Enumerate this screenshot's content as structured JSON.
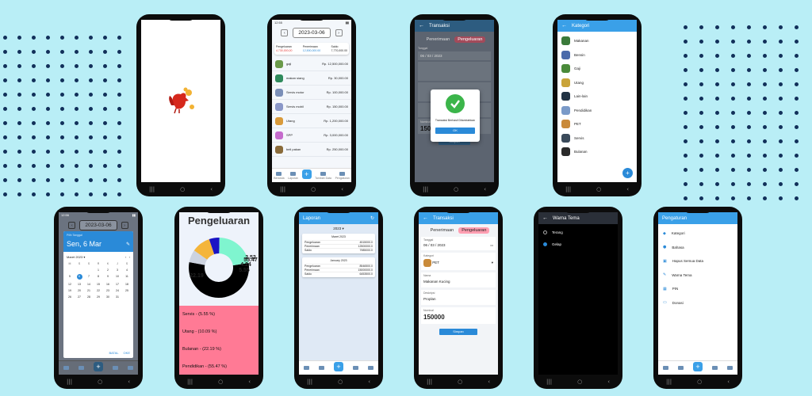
{
  "colors": {
    "background": "#b9eef6",
    "dots": "#12305a",
    "accent": "#3aa0e8",
    "expense_pink": "#ff7a95"
  },
  "phone1": {
    "logo": "rooster-logo"
  },
  "phone2": {
    "date": "2023-03-06",
    "summary": {
      "expense_label": "Pengeluaran",
      "expense_value": "4.730,000,00",
      "income_label": "Penerimaan",
      "income_value": "12,500,000.00",
      "balance_label": "Saldo",
      "balance_value": "7,770,000.00"
    },
    "items": [
      {
        "name": "gaji",
        "amount": "Rp. 12,500,000.00",
        "color": "#6b9a4a"
      },
      {
        "name": "makan siang",
        "amount": "Rp. 30,000.00",
        "color": "#2f8a5c"
      },
      {
        "name": "Servis motor",
        "amount": "Rp. 100,000.00",
        "color": "#7b8fb8"
      },
      {
        "name": "Servis mobil",
        "amount": "Rp. 150,000.00",
        "color": "#8a97c8"
      },
      {
        "name": "Utang",
        "amount": "Rp. 1,200,000.00",
        "color": "#d99a3a"
      },
      {
        "name": "SPP",
        "amount": "Rp. 3,000,000.00",
        "color": "#c56bcc"
      },
      {
        "name": "beli pakan",
        "amount": "Rp. 250,000.00",
        "color": "#8a6b3a"
      }
    ],
    "nav": [
      "Beranda",
      "Laporan",
      "Tambah Data",
      "Pengaturan"
    ]
  },
  "phone3": {
    "appbar": "Transaksi",
    "tab_income": "Penerimaan",
    "tab_expense": "Pengeluaran",
    "date_label": "Tanggal",
    "date_value": "06 / 03 / 2023",
    "dialog_text": "Transaksi Berhasil Ditambahkan",
    "dialog_button": "OK",
    "nominal_label": "Nominal",
    "nominal_value": "150000",
    "submit": "Simpan"
  },
  "phone4": {
    "appbar": "Kategori",
    "items": [
      {
        "name": "Makanan",
        "color": "#3a7a3a"
      },
      {
        "name": "Bensin",
        "color": "#4a6aaa"
      },
      {
        "name": "Gaji",
        "color": "#4a8a3a"
      },
      {
        "name": "Utang",
        "color": "#c9a43a"
      },
      {
        "name": "Lain-lain",
        "color": "#223344"
      },
      {
        "name": "Pendidikan",
        "color": "#7a9ac8"
      },
      {
        "name": "PET",
        "color": "#c98a3a"
      },
      {
        "name": "Servis",
        "color": "#3a4a5a"
      },
      {
        "name": "Bulanan",
        "color": "#2a2a2a"
      }
    ],
    "fab": "+"
  },
  "phone5": {
    "date": "2023-03-06",
    "picker_label": "Pilih Tanggal",
    "picker_date": "Sen, 6 Mar",
    "month": "Maret 2023",
    "weekdays": [
      "M",
      "S",
      "S",
      "R",
      "K",
      "J",
      "S"
    ],
    "days": [
      "",
      "",
      "",
      "1",
      "2",
      "3",
      "4",
      "5",
      "6",
      "7",
      "8",
      "9",
      "10",
      "11",
      "12",
      "13",
      "14",
      "15",
      "16",
      "17",
      "18",
      "19",
      "20",
      "21",
      "22",
      "23",
      "24",
      "25",
      "26",
      "27",
      "28",
      "29",
      "30",
      "31"
    ],
    "selected_day": "6",
    "cancel": "BATAL",
    "ok": "OKE"
  },
  "phone6": {
    "title": "Pengeluaran",
    "chart_data": {
      "type": "pie",
      "categories": [
        "Servis",
        "Utang",
        "Bulanan",
        "Pendidikan",
        "Other"
      ],
      "values": [
        5.55,
        10.09,
        22.19,
        55.47,
        6.7
      ],
      "data_labels": [
        "5.55",
        "4.24",
        "22.19",
        "55.47",
        "2.52"
      ],
      "colors": [
        "#1a14c4",
        "#f4b53a",
        "#7ff5cf",
        "#000000",
        "#ccd3e0"
      ]
    },
    "legend": [
      "Servis - (5.55 %)",
      "Utang - (10.09 %)",
      "Bulanan - (22.19 %)",
      "Pendidikan - (55.47 %)"
    ]
  },
  "phone7": {
    "appbar": "Laporan",
    "year": "2023",
    "reports": [
      {
        "month": "Maret 2023",
        "expense_label": "Pengeluaran",
        "expense": "4515000.0",
        "income_label": "Penerimaan",
        "income": "12500000.0",
        "balance_label": "Saldo",
        "balance": "7985000.0"
      },
      {
        "month": "January 2023",
        "expense_label": "Pengeluaran",
        "expense": "8546500.0",
        "income_label": "Penerimaan",
        "income": "15000000.0",
        "balance_label": "Saldo",
        "balance": "6453500.0"
      }
    ]
  },
  "phone8": {
    "appbar": "Transaksi",
    "tab_income": "Penerimaan",
    "tab_expense": "Pengeluaran",
    "date_label": "Tanggal",
    "date_value": "06 / 03 / 2023",
    "category_label": "Kategori",
    "category_value": "PET",
    "name_label": "Nama",
    "name_value": "Makanan Kucing",
    "desc_label": "Deskripsi",
    "desc_value": "Proplan",
    "nominal_label": "Nominal",
    "nominal_value": "150000",
    "submit": "Simpan"
  },
  "phone9": {
    "appbar": "Warna Tema",
    "options": [
      "Terang",
      "Gelap"
    ],
    "selected": "Gelap"
  },
  "phone10": {
    "appbar": "Pengaturan",
    "items": [
      "Kategori",
      "Bahasa",
      "Hapus Semua Data",
      "Warna Tema",
      "PIN",
      "Donasi"
    ]
  }
}
